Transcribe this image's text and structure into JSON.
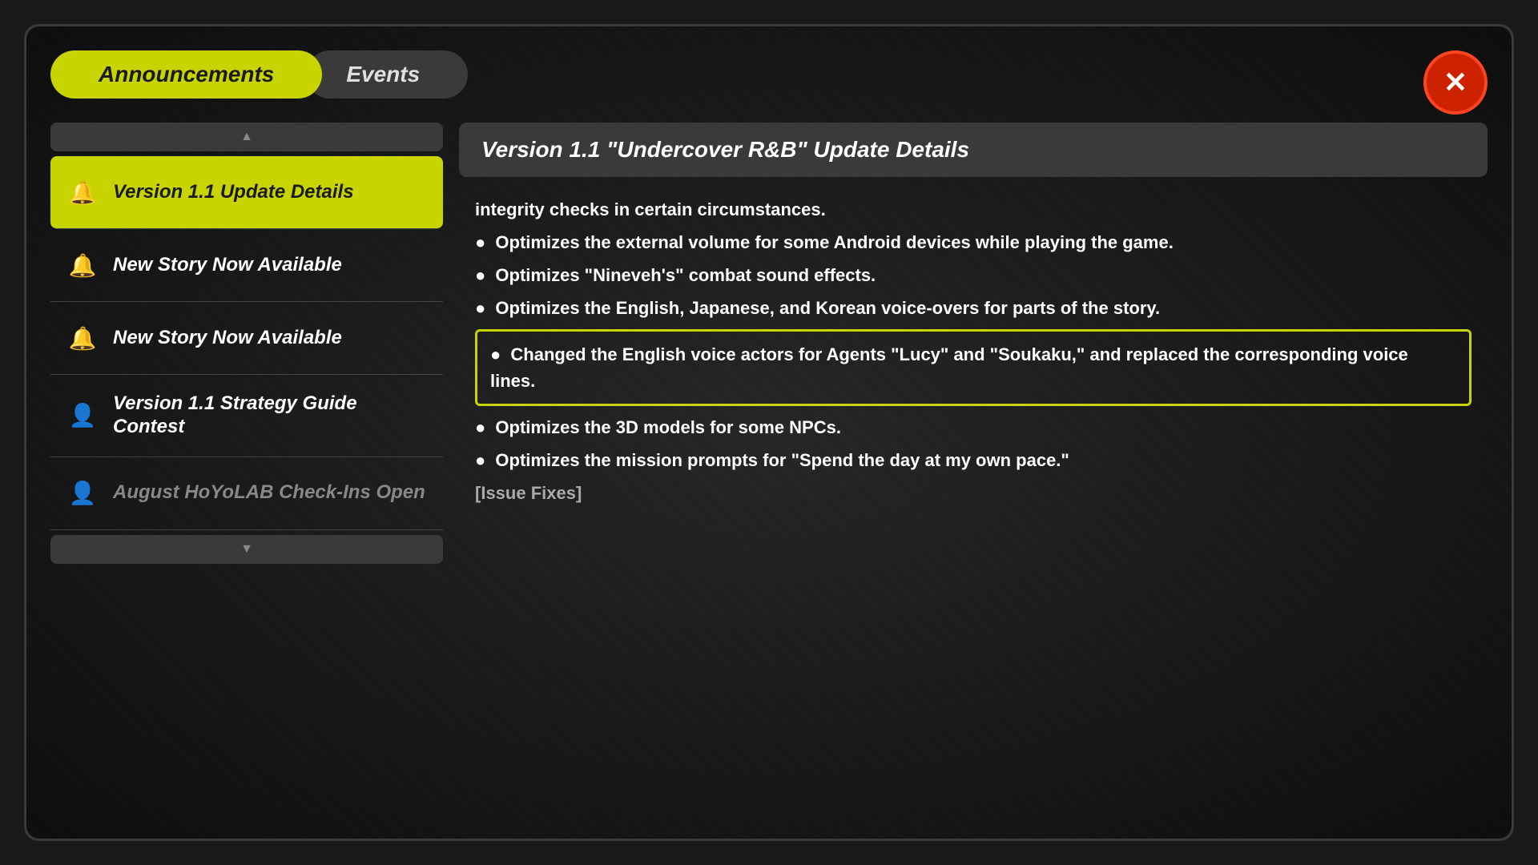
{
  "tabs": {
    "announcements": "Announcements",
    "events": "Events"
  },
  "close_label": "✕",
  "sidebar": {
    "items": [
      {
        "id": "version-update",
        "icon": "bell",
        "label": "Version 1.1 Update Details",
        "active": true
      },
      {
        "id": "new-story-1",
        "icon": "bell",
        "label": "New Story Now Available",
        "active": false
      },
      {
        "id": "new-story-2",
        "icon": "bell",
        "label": "New Story Now Available",
        "active": false
      },
      {
        "id": "strategy-guide",
        "icon": "person",
        "label": "Version 1.1 Strategy Guide Contest",
        "active": false
      },
      {
        "id": "hoyolab",
        "icon": "person",
        "label": "August HoYoLAB Check-Ins Open",
        "active": false,
        "faded": true
      }
    ]
  },
  "detail": {
    "title": "Version 1.1 \"Undercover R&B\" Update Details",
    "content_lines": [
      {
        "type": "text",
        "text": "integrity checks in certain circumstances."
      },
      {
        "type": "bullet",
        "text": "Optimizes the external volume for some Android devices while playing the game."
      },
      {
        "type": "bullet",
        "text": "Optimizes \"Nineveh's\" combat sound effects."
      },
      {
        "type": "bullet",
        "text": "Optimizes the English, Japanese, and Korean voice-overs for parts of the story."
      },
      {
        "type": "highlighted_bullet",
        "text": "Changed the English voice actors for Agents \"Lucy\" and \"Soukaku,\" and replaced the corresponding voice lines."
      },
      {
        "type": "bullet",
        "text": "Optimizes the 3D models for some NPCs."
      },
      {
        "type": "bullet",
        "text": "Optimizes the mission prompts for \"Spend the day at my own pace.\""
      },
      {
        "type": "text",
        "text": "[Issue Fixes]",
        "faded": true
      }
    ]
  },
  "colors": {
    "accent": "#c8d400",
    "close_bg": "#cc2200",
    "close_border": "#ff4422",
    "panel_bg": "#3a3a3a",
    "highlight_border": "#c8d400"
  }
}
